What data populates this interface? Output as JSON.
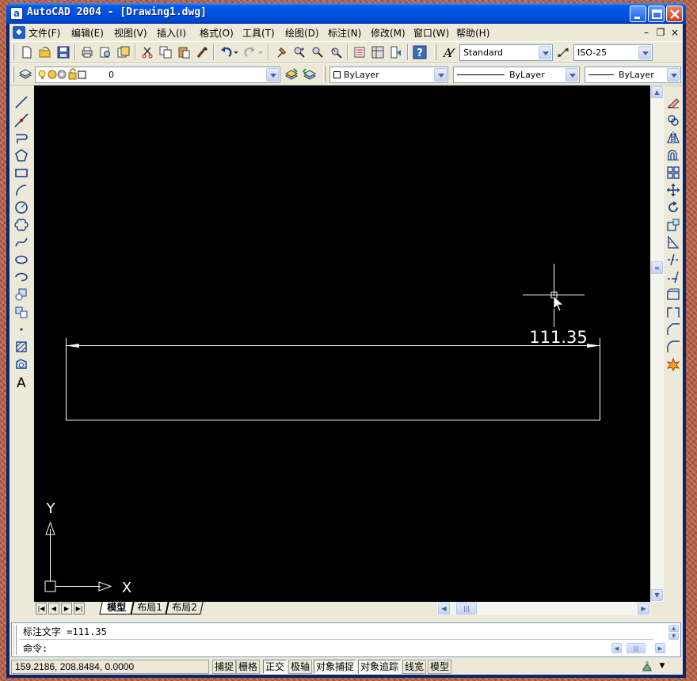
{
  "window": {
    "title": "AutoCAD 2004 - [Drawing1.dwg]",
    "app_icon": "a"
  },
  "menu": {
    "items": [
      "文件(F)",
      "编辑(E)",
      "视图(V)",
      "插入(I)",
      "格式(O)",
      "工具(T)",
      "绘图(D)",
      "标注(N)",
      "修改(M)",
      "窗口(W)",
      "帮助(H)"
    ]
  },
  "toolbar": {
    "text_style": "Standard",
    "dim_style": "ISO-25",
    "layer": "0",
    "color": "ByLayer",
    "linetype": "ByLayer",
    "lineweight": "ByLayer"
  },
  "drawing": {
    "dimension_text": "111.35",
    "ucs_x_label": "X",
    "ucs_y_label": "Y"
  },
  "layout_tabs": [
    "模型",
    "布局1",
    "布局2"
  ],
  "active_tab": "模型",
  "command": {
    "history_line": "标注文字 =111.35",
    "prompt": "命令:"
  },
  "status": {
    "coordinates": "159.2186, 208.8484, 0.0000",
    "buttons": [
      {
        "label": "捕捉",
        "on": false
      },
      {
        "label": "栅格",
        "on": false
      },
      {
        "label": "正交",
        "on": true
      },
      {
        "label": "极轴",
        "on": false
      },
      {
        "label": "对象捕捉",
        "on": true
      },
      {
        "label": "对象追踪",
        "on": true
      },
      {
        "label": "线宽",
        "on": false
      },
      {
        "label": "模型",
        "on": false
      }
    ]
  },
  "colors": {
    "canvas": "#000000",
    "drawing_lines": "#ffffff",
    "titlebar": "#0054e3",
    "chrome": "#ece9d8"
  }
}
